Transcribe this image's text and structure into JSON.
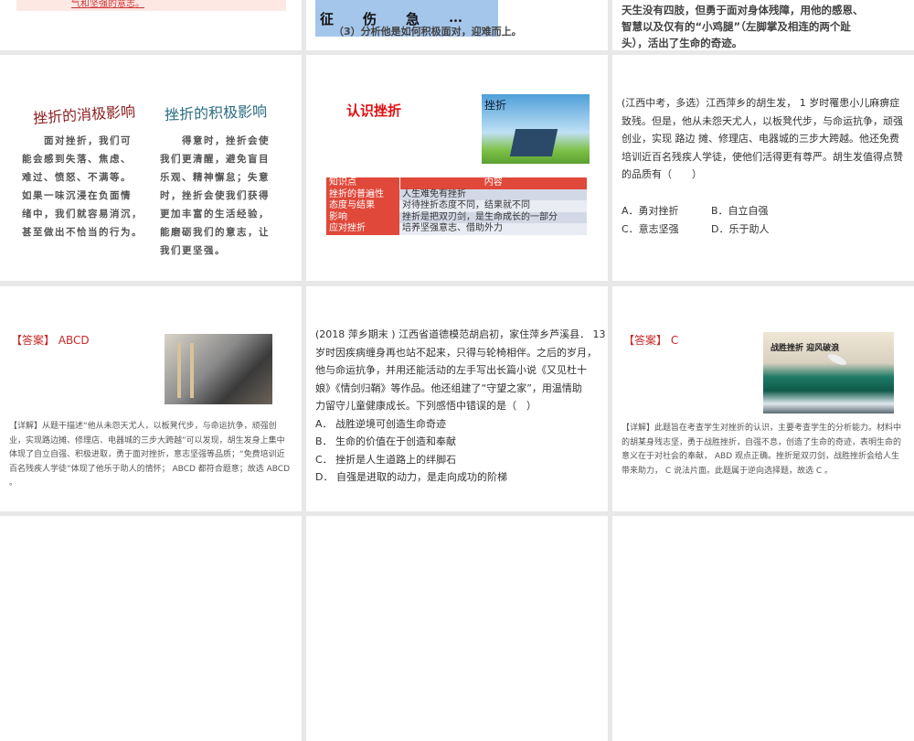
{
  "slides_row1": {
    "s1_text": "气和坚强的意志。",
    "s2_chars": [
      "征",
      "伤",
      "急",
      "…"
    ],
    "s2_text": "（3）分析他是如何积极面对，迎难而上。",
    "s3_lines": [
      "天生没有四肢，但勇于面对身体残障，用他的感恩、",
      "智慧以及仅有的“小鸡腿”（左脚掌及相连的两个趾",
      "头），活出了生命的奇迹。"
    ]
  },
  "slide_influence": {
    "neg_title": "挫折的消极影响",
    "pos_title": "挫折的积极影响",
    "neg_lines": [
      "　　面对挫折，我们可",
      "能会感到失落、焦虑、",
      "难过、愤怒、不满等。",
      "如果一味沉浸在负面情",
      "绪中，我们就容易消沉，",
      "甚至做出不恰当的行为。"
    ],
    "pos_lines": [
      "　　得意时，挫折会使",
      "我们更清醒，避免盲目",
      "乐观、精神懈怠；失意",
      "时，挫折会使我们获得",
      "更加丰富的生活经验，",
      "能磨砺我们的意志，让",
      "我们更坚强。"
    ]
  },
  "slide_know": {
    "title": "认识挫折",
    "image_title": "挫折",
    "header": [
      "知识点",
      "内容"
    ],
    "rows": [
      [
        "挫折的普遍性",
        "人生难免有挫折"
      ],
      [
        "态度与结果",
        "对待挫折态度不同，结果就不同"
      ],
      [
        "影响",
        "挫折是把双刃剑，是生命成长的一部分"
      ],
      [
        "应对挫折",
        "培养坚强意志、借助外力"
      ]
    ],
    "colors": {
      "header": "#e0483a",
      "key": "#e0483a",
      "row_a": "#d3d8e6",
      "row_b": "#e9ecf3"
    }
  },
  "slide_q1": {
    "lines": [
      "(江西中考，多选）江西萍乡的胡生发， 1 岁时罹患小儿麻痹症",
      "致残。但是，他从未怨天尤人，以板凳代步，与命运抗争，顽强",
      "创业，实现 路边 摊、修理店、电器城的三步大跨越。他还免费",
      "培训近百名残疾人学徒，使他们活得更有尊严。胡生发值得点赞",
      "的品质有（　　）"
    ],
    "options": [
      "A．勇对挫折",
      "B．自立自强",
      "C．意志坚强",
      "D．乐于助人"
    ]
  },
  "slide_a1": {
    "answer": "【答案】 ABCD",
    "detail": "【详解】从题干描述“他从未怨天尤人，以板凳代步，与命运抗争，顽强创业，实现路边摊、修理店、电器城的三步大跨越”可以发现，胡生发身上集中体现了自立自强、积极进取，勇于面对挫折，意志坚强等品质；“免费培训近百名残疾人学徒”体现了他乐于助人的情怀； ABCD 都符合题意；故选 ABCD 。"
  },
  "slide_q2": {
    "lines": [
      "(2018 萍乡期末 ) 江西省道德模范胡启初，家住萍乡芦溪县． 13",
      "岁时因疾病缠身再也站不起来，只得与轮椅相伴。之后的岁月，",
      "他与命运抗争，并用还能活动的左手写出长篇小说《又见杜十",
      "娘》《情剑归鞘》等作品。他还组建了“守望之家”，用温情助",
      "力留守儿童健康成长。下列感悟中错误的是（　）"
    ],
    "options": [
      "A．  战胜逆境可创造生命奇迹",
      "B．  生命的价值在于创造和奉献",
      "C．  挫折是人生道路上的绊脚石",
      "D．  自强是进取的动力，是走向成功的阶梯"
    ]
  },
  "slide_a2": {
    "answer": "【答案】 C",
    "image_caption": "战胜挫折  迎风破浪",
    "detail": "【详解】此题旨在考查学生对挫折的认识，主要考查学生的分析能力。材料中的胡某身残志坚，勇于战胜挫折，自强不息，创造了生命的奇迹，表明生命的意义在于对社会的奉献， ABD 观点正确。挫折是双刃剑，战胜挫折会给人生带来助力， C 说法片面。此题属于逆向选择题，故选 C 。"
  }
}
